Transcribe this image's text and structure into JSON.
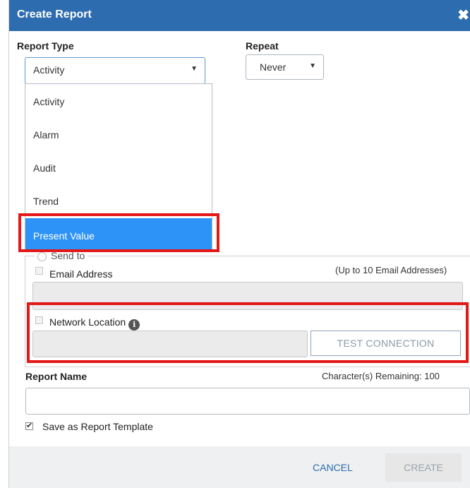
{
  "dialog": {
    "title": "Create Report",
    "close_glyph": "✖"
  },
  "report_type": {
    "label": "Report Type",
    "selected": "Activity",
    "options": [
      "Activity",
      "Alarm",
      "Audit",
      "Trend",
      "Present Value"
    ],
    "highlighted_option": "Present Value"
  },
  "repeat": {
    "label": "Repeat",
    "selected": "Never"
  },
  "delivery": {
    "send_to_label": "Send to",
    "email": {
      "label": "Email Address",
      "hint": "(Up to 10 Email Addresses)",
      "value": ""
    },
    "network": {
      "label": "Network Location",
      "info_icon": "info-icon",
      "value": "",
      "test_button": "TEST CONNECTION"
    }
  },
  "report_name": {
    "label": "Report Name",
    "remaining": "Character(s) Remaining: 100",
    "value": ""
  },
  "template": {
    "label": "Save as Report Template",
    "checked": true
  },
  "footer": {
    "cancel": "CANCEL",
    "create": "CREATE"
  },
  "colors": {
    "title_bar": "#2d6cae",
    "selected_option": "#2e93f7",
    "highlight_box": "#e41818"
  }
}
